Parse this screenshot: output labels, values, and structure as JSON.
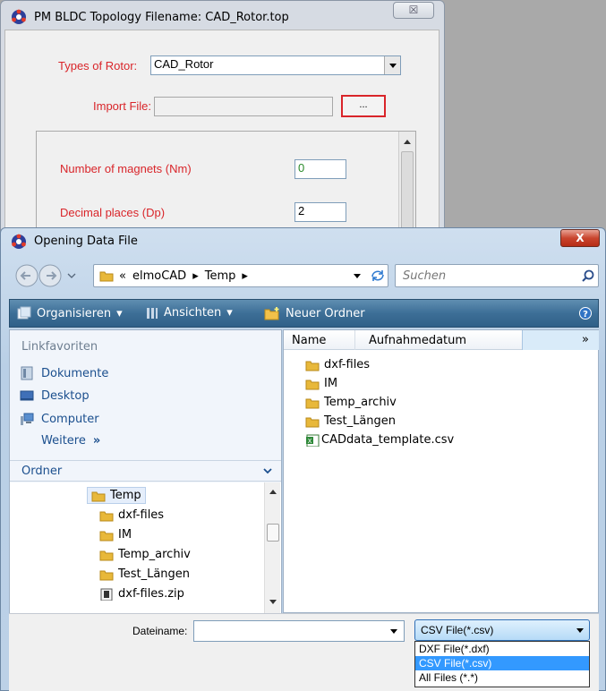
{
  "bg_window": {
    "title": "PM BLDC   Topology Filename: CAD_Rotor.top",
    "close_label": "☒",
    "types_label": "Types of Rotor:",
    "types_value": "CAD_Rotor",
    "import_label": "Import File:",
    "import_button": "...",
    "magnets_label": "Number of magnets  (Nm)",
    "magnets_value": "0",
    "decimal_label": "Decimal places  (Dp)",
    "decimal_value": "2"
  },
  "dialog": {
    "title": "Opening Data File",
    "close_label": "X",
    "breadcrumb": {
      "prefix": "«",
      "items": [
        "elmoCAD",
        "Temp"
      ]
    },
    "search_placeholder": "Suchen",
    "toolbar": {
      "organize": "Organisieren",
      "views": "Ansichten",
      "new_folder": "Neuer Ordner"
    },
    "favorites": {
      "header": "Linkfavoriten",
      "items": [
        "Dokumente",
        "Desktop",
        "Computer"
      ],
      "more": "Weitere"
    },
    "folders": {
      "header": "Ordner",
      "items": [
        "Temp",
        "dxf-files",
        "IM",
        "Temp_archiv",
        "Test_Längen",
        "dxf-files.zip"
      ]
    },
    "columns": [
      "Name",
      "Aufnahmedatum"
    ],
    "files": [
      {
        "name": "dxf-files",
        "icon": "folder-icon"
      },
      {
        "name": "IM",
        "icon": "folder-icon"
      },
      {
        "name": "Temp_archiv",
        "icon": "folder-icon"
      },
      {
        "name": "Test_Längen",
        "icon": "folder-icon"
      },
      {
        "name": "CADdata_template.csv",
        "icon": "excel-file-icon"
      }
    ],
    "filename_label": "Dateiname:",
    "filename_value": "",
    "filetype_value": "CSV File(*.csv)",
    "filetype_options": [
      "DXF File(*.dxf)",
      "CSV File(*.csv)",
      "All Files (*.*)"
    ],
    "colors": {
      "toolbar": "#3d6f97",
      "selection": "#3399ff",
      "label_red": "#d9252a"
    }
  }
}
